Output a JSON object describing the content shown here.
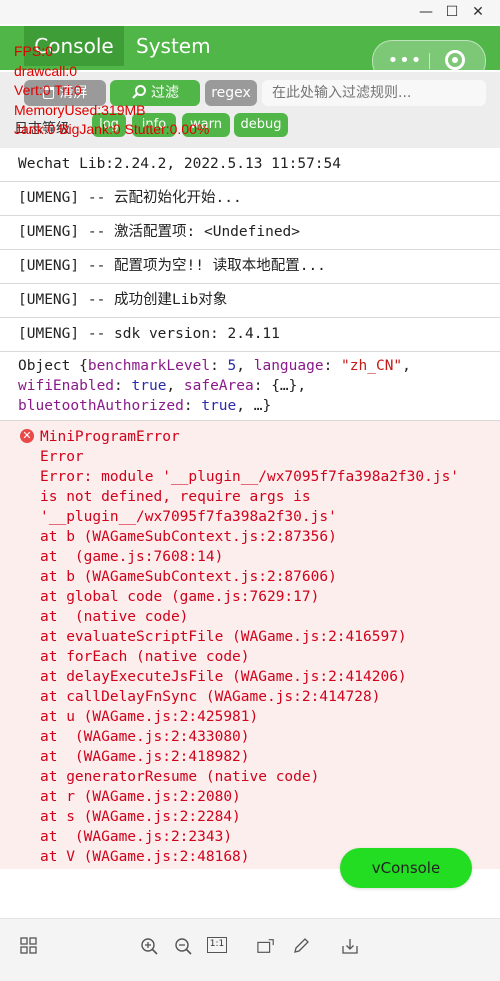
{
  "window": {
    "minimize": "—",
    "maximize": "☐",
    "close": "✕"
  },
  "tabs": [
    {
      "label": "Console",
      "active": true
    },
    {
      "label": "System",
      "active": false
    }
  ],
  "capsule": {
    "more_label": "•••",
    "close_icon": "target-icon"
  },
  "perf": {
    "fps": "FPS:0",
    "drawcall": "drawcall:0",
    "vert": "Vert:0  Tri:0",
    "memory": "MemoryUsed:319MB",
    "jank": "Jank:0 BigJank:0 Stutter:0.00%"
  },
  "toolbar": {
    "clear_label": "清屏",
    "filter_label": "过滤",
    "regex_label": "regex",
    "filter_placeholder": "在此处输入过滤规则...",
    "level_label": "日志等级",
    "levels": [
      "log",
      "info",
      "warn",
      "debug"
    ]
  },
  "logs": [
    "Wechat Lib:2.24.2, 2022.5.13 11:57:54",
    "[UMENG] -- 云配初始化开始...",
    "[UMENG] -- 激活配置项:  <Undefined>",
    "[UMENG] -- 配置项为空!! 读取本地配置...",
    "[UMENG] -- 成功创建Lib对象",
    "[UMENG] -- sdk version: 2.4.11"
  ],
  "object_log": {
    "prefix": "Object {",
    "k1": "benchmarkLevel",
    "v1": "5",
    "k2": "language",
    "v2": "\"zh_CN\"",
    "k3": "wifiEnabled",
    "v3": "true",
    "k4": "safeArea",
    "v4": "{…}",
    "k5": "bluetoothAuthorized",
    "v5": "true",
    "suffix": "…}"
  },
  "error": {
    "title": "MiniProgramError",
    "lines": [
      "Error",
      "Error: module '__plugin__/wx7095f7fa398a2f30.js' is not defined, require args is '__plugin__/wx7095f7fa398a2f30.js'",
      "at b (WAGameSubContext.js:2:87356)",
      "at  (game.js:7608:14)",
      "at b (WAGameSubContext.js:2:87606)",
      "at global code (game.js:7629:17)",
      "at  (native code)",
      "at evaluateScriptFile (WAGame.js:2:416597)",
      "at forEach (native code)",
      "at delayExecuteJsFile (WAGame.js:2:414206)",
      "at callDelayFnSync (WAGame.js:2:414728)",
      "at u (WAGame.js:2:425981)",
      "at  (WAGame.js:2:433080)",
      "at  (WAGame.js:2:418982)",
      "at generatorResume (native code)",
      "at r (WAGame.js:2:2080)",
      "at s (WAGame.js:2:2284)",
      "at  (WAGame.js:2:2343)",
      "at V (WAGame.js:2:48168)"
    ]
  },
  "vconsole_label": "vConsole",
  "bottom_icons": [
    "grid-icon",
    "zoom-in-icon",
    "zoom-out-icon",
    "actual-size-icon",
    "rotate-icon",
    "edit-icon",
    "download-icon"
  ],
  "actual_size_text": "1:1"
}
